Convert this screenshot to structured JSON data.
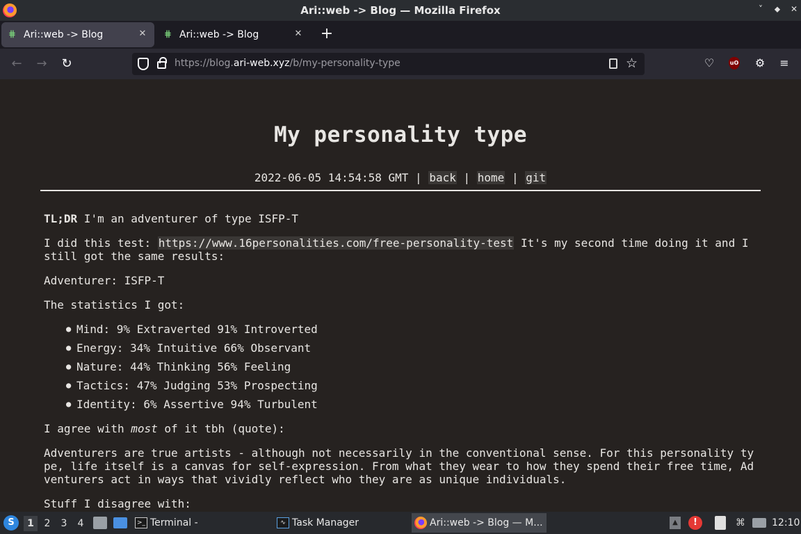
{
  "window": {
    "title": "Ari::web -> Blog — Mozilla Firefox",
    "controls": [
      "minimize-icon",
      "restore-icon",
      "close-icon"
    ]
  },
  "tabs": [
    {
      "label": "Ari::web -> Blog",
      "active": true
    },
    {
      "label": "Ari::web -> Blog",
      "active": false
    }
  ],
  "urlbar": {
    "prefix": "https://blog.",
    "host": "ari-web.xyz",
    "path": "/b/my-personality-type"
  },
  "post": {
    "title": "My personality type",
    "date": "2022-06-05 14:54:58 GMT",
    "sep": "|",
    "links": {
      "back": "back",
      "home": "home",
      "git": "git"
    },
    "tldr_label": "TL;DR",
    "tldr_text": " I'm an adventurer of type ISFP-T",
    "test_intro": "I did this test: ",
    "test_link": "https://www.16personalities.com/free-personality-test",
    "test_outro": " It's my second time doing it and I still got the same results:",
    "type_line": "Adventurer: ISFP-T",
    "stats_heading": "The statistics I got:",
    "stats": [
      "Mind: 9% Extraverted 91% Introverted",
      "Energy: 34% Intuitive 66% Observant",
      "Nature: 44% Thinking 56% Feeling",
      "Tactics: 47% Judging 53% Prospecting",
      "Identity: 6% Assertive 94% Turbulent"
    ],
    "agree_before": "I agree with ",
    "agree_em": "most",
    "agree_after": " of it tbh (quote):",
    "quote_lines": [
      "Adventurers are true artists - although not necessarily in the conventional sense. For this personality ty",
      "pe, life itself is a canvas for self-expression. From what they wear to how they spend their free time, Ad",
      "venturers act in ways that vividly reflect who they are as unique individuals."
    ],
    "disagree": "Stuff I disagree with:"
  },
  "taskbar": {
    "workspaces": [
      "1",
      "2",
      "3",
      "4"
    ],
    "terminal": "Terminal -",
    "task_manager": "Task Manager",
    "firefox": "Ari::web -> Blog — M...",
    "clock": "12:10"
  }
}
